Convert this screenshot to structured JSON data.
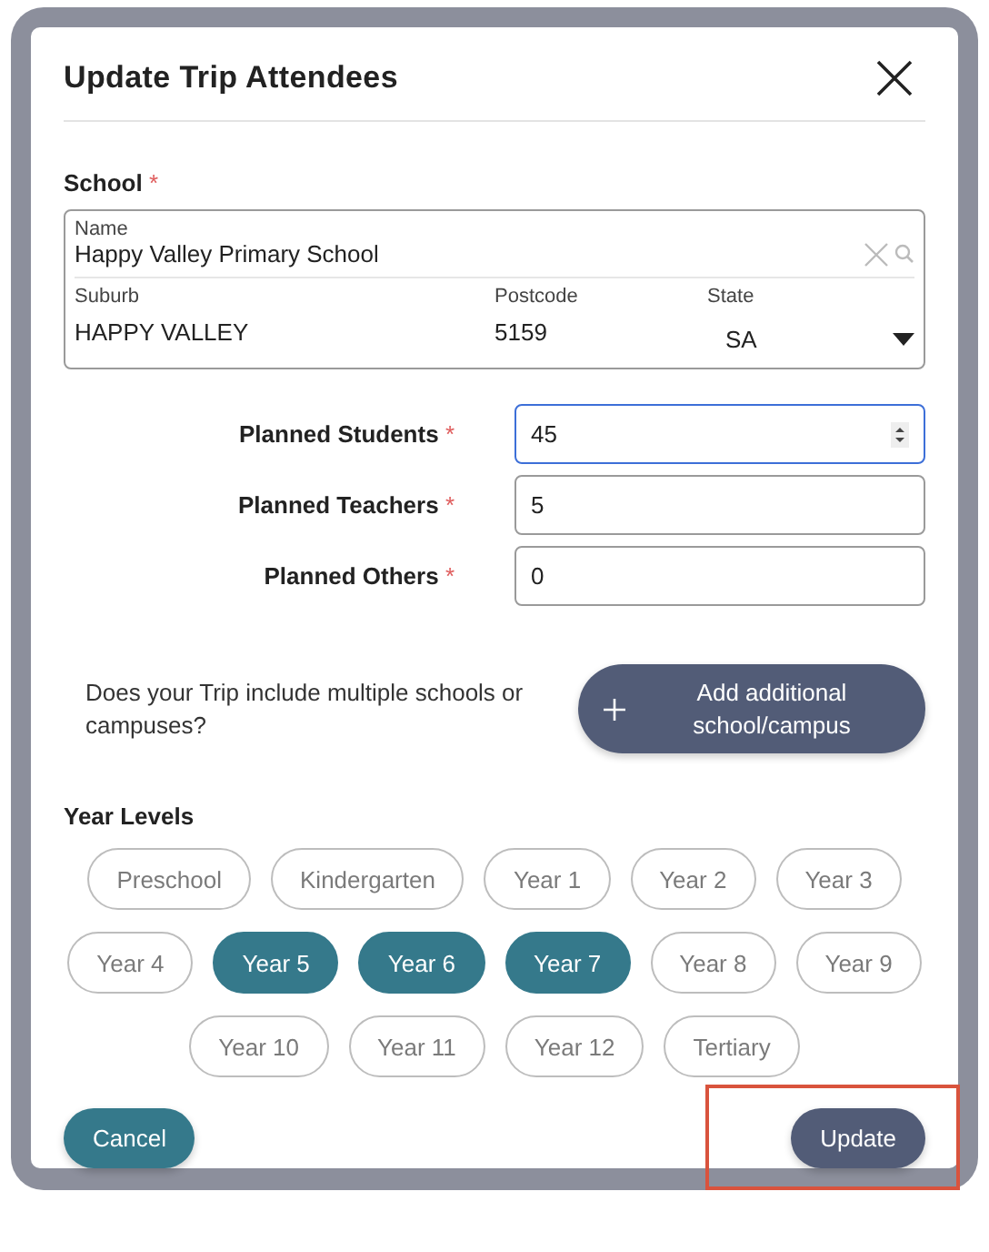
{
  "dialog": {
    "title": "Update Trip Attendees"
  },
  "school": {
    "label": "School",
    "required_mark": "*",
    "name_field": {
      "label": "Name",
      "value": "Happy Valley Primary School"
    },
    "suburb": {
      "label": "Suburb",
      "value": "HAPPY VALLEY"
    },
    "postcode": {
      "label": "Postcode",
      "value": "5159"
    },
    "state": {
      "label": "State",
      "value": "SA"
    }
  },
  "attendees": [
    {
      "label": "Planned Students",
      "required_mark": "*",
      "value": "45",
      "focused": true
    },
    {
      "label": "Planned Teachers",
      "required_mark": "*",
      "value": "5",
      "focused": false
    },
    {
      "label": "Planned Others",
      "required_mark": "*",
      "value": "0",
      "focused": false
    }
  ],
  "multiple_schools": {
    "question": "Does your Trip include multiple schools or campuses?",
    "button": "Add additional school/campus"
  },
  "year_levels": {
    "label": "Year Levels",
    "levels": [
      {
        "label": "Preschool",
        "selected": false
      },
      {
        "label": "Kindergarten",
        "selected": false
      },
      {
        "label": "Year 1",
        "selected": false
      },
      {
        "label": "Year 2",
        "selected": false
      },
      {
        "label": "Year 3",
        "selected": false
      },
      {
        "label": "Year 4",
        "selected": false
      },
      {
        "label": "Year 5",
        "selected": true
      },
      {
        "label": "Year 6",
        "selected": true
      },
      {
        "label": "Year 7",
        "selected": true
      },
      {
        "label": "Year 8",
        "selected": false
      },
      {
        "label": "Year 9",
        "selected": false
      },
      {
        "label": "Year 10",
        "selected": false
      },
      {
        "label": "Year 11",
        "selected": false
      },
      {
        "label": "Year 12",
        "selected": false
      },
      {
        "label": "Tertiary",
        "selected": false
      }
    ]
  },
  "actions": {
    "cancel": "Cancel",
    "update": {
      "label": "Update",
      "highlighted": true
    }
  }
}
